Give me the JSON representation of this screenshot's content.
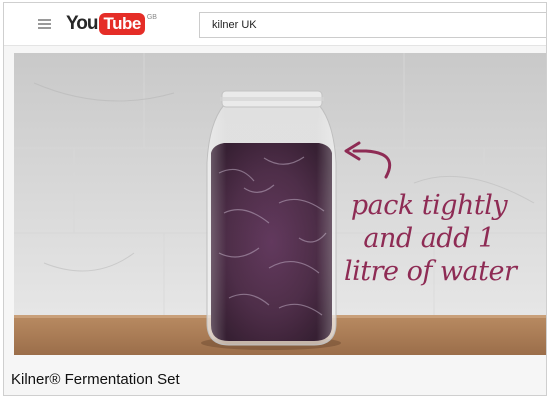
{
  "header": {
    "logo_you": "You",
    "logo_tube": "Tube",
    "logo_region": "GB",
    "search_value": "kilner UK"
  },
  "video": {
    "caption_lines": [
      "pack tightly",
      "and add 1",
      "litre of water"
    ]
  },
  "title": "Kilner® Fermentation Set",
  "colors": {
    "brand_red": "#e52d27",
    "caption": "#8e2b54"
  },
  "icons": [
    "menu-icon",
    "curved-arrow-icon"
  ]
}
